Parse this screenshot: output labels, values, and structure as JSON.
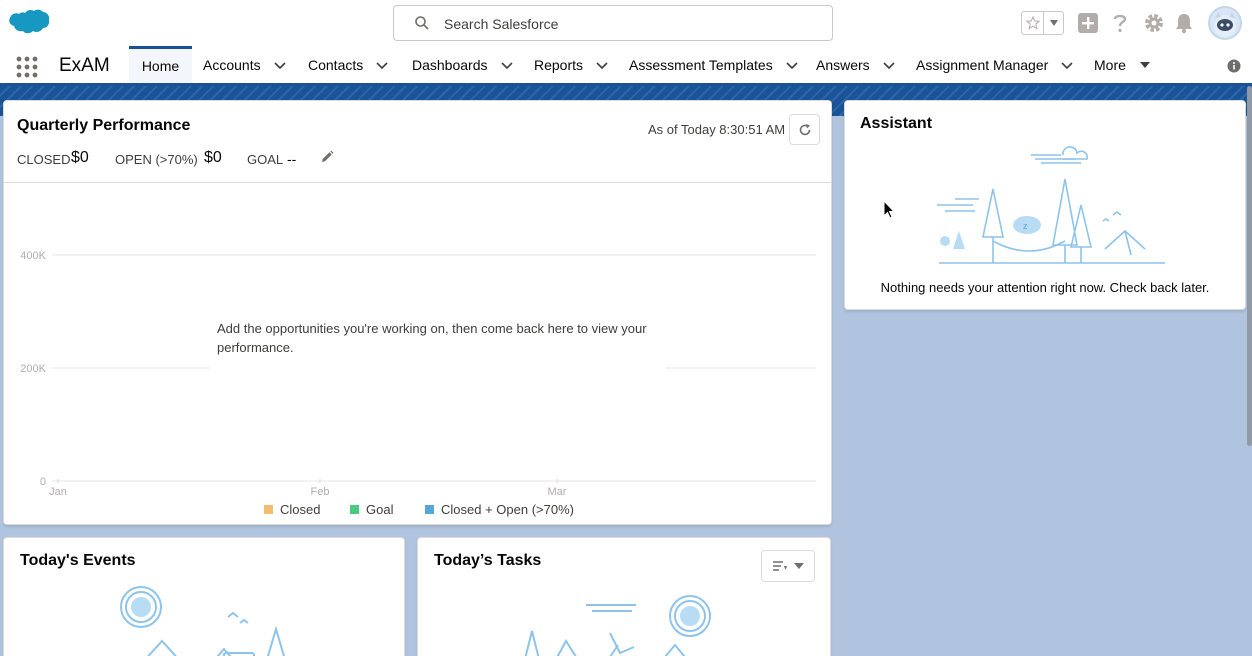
{
  "header": {
    "search_placeholder": "Search Salesforce"
  },
  "nav": {
    "app_name": "ExAM",
    "items": [
      {
        "label": "Home"
      },
      {
        "label": "Accounts"
      },
      {
        "label": "Contacts"
      },
      {
        "label": "Dashboards"
      },
      {
        "label": "Reports"
      },
      {
        "label": "Assessment Templates"
      },
      {
        "label": "Answers"
      },
      {
        "label": "Assignment Manager"
      },
      {
        "label": "More"
      }
    ]
  },
  "quarterly_performance": {
    "title": "Quarterly Performance",
    "as_of": "As of Today 8:30:51 AM",
    "closed_label": "CLOSED",
    "closed_value": "$0",
    "open_label": "OPEN (>70%)",
    "open_value": "$0",
    "goal_label": "GOAL",
    "goal_value": "--",
    "empty_message": "Add the opportunities you're working on, then come back here to view your performance.",
    "legend": [
      "Closed",
      "Goal",
      "Closed + Open (>70%)"
    ],
    "colors": {
      "closed": "#f4bc6c",
      "goal": "#4bca81",
      "closed_open": "#54a7d8"
    }
  },
  "chart_data": {
    "type": "line",
    "x_ticks": [
      "Jan",
      "Feb",
      "Mar"
    ],
    "y_ticks": [
      "400K",
      "200K",
      "0"
    ],
    "ylim": [
      0,
      400000
    ],
    "series": [
      {
        "name": "Closed",
        "values": []
      },
      {
        "name": "Goal",
        "values": []
      },
      {
        "name": "Closed + Open (>70%)",
        "values": []
      }
    ],
    "legend_position": "bottom",
    "grid": true
  },
  "assistant": {
    "title": "Assistant",
    "message": "Nothing needs your attention right now. Check back later."
  },
  "events": {
    "title": "Today's Events"
  },
  "tasks": {
    "title": "Today’s Tasks"
  }
}
